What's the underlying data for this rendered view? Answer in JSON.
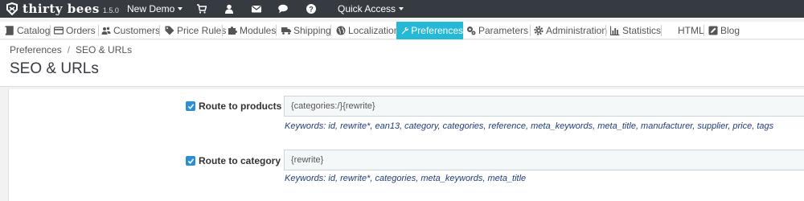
{
  "topbar": {
    "logo_text": "thirty bees",
    "version": "1.5.0",
    "demo_label": "New Demo",
    "quick_access_label": "Quick Access",
    "icons": [
      "shopping-cart-icon",
      "user-icon",
      "envelope-icon",
      "chat-bubble-icon",
      "help-icon"
    ]
  },
  "nav": {
    "items": [
      {
        "label": "Catalog",
        "icon": "book-icon"
      },
      {
        "label": "Orders",
        "icon": "credit-card-icon"
      },
      {
        "label": "Customers",
        "icon": "users-icon"
      },
      {
        "label": "Price Rules",
        "icon": "tag-icon"
      },
      {
        "label": "Modules",
        "icon": "puzzle-icon"
      },
      {
        "label": "Shipping",
        "icon": "truck-icon"
      },
      {
        "label": "Localization",
        "icon": "globe-icon"
      },
      {
        "label": "Preferences",
        "icon": "wrench-icon",
        "active": true
      },
      {
        "label": "Parameters",
        "icon": "cogs-icon"
      },
      {
        "label": "Administration",
        "icon": "gear-icon"
      },
      {
        "label": "Statistics",
        "icon": "bar-chart-icon"
      },
      {
        "label": "HTML",
        "icon": ""
      },
      {
        "label": "Blog",
        "icon": "edit-icon"
      }
    ],
    "active_color": "#25b9d7"
  },
  "header": {
    "breadcrumb": [
      "Preferences",
      "SEO & URLs"
    ],
    "breadcrumb_sep": "/",
    "title": "SEO & URLs"
  },
  "routes": [
    {
      "label": "Route to products",
      "checked": true,
      "value": "{categories:/}{rewrite}",
      "keywords": "Keywords: id, rewrite*, ean13, category, categories, reference, meta_keywords, meta_title, manufacturer, supplier, price, tags"
    },
    {
      "label": "Route to category",
      "checked": true,
      "value": "{rewrite}",
      "keywords": "Keywords: id, rewrite*, categories, meta_keywords, meta_title"
    }
  ]
}
